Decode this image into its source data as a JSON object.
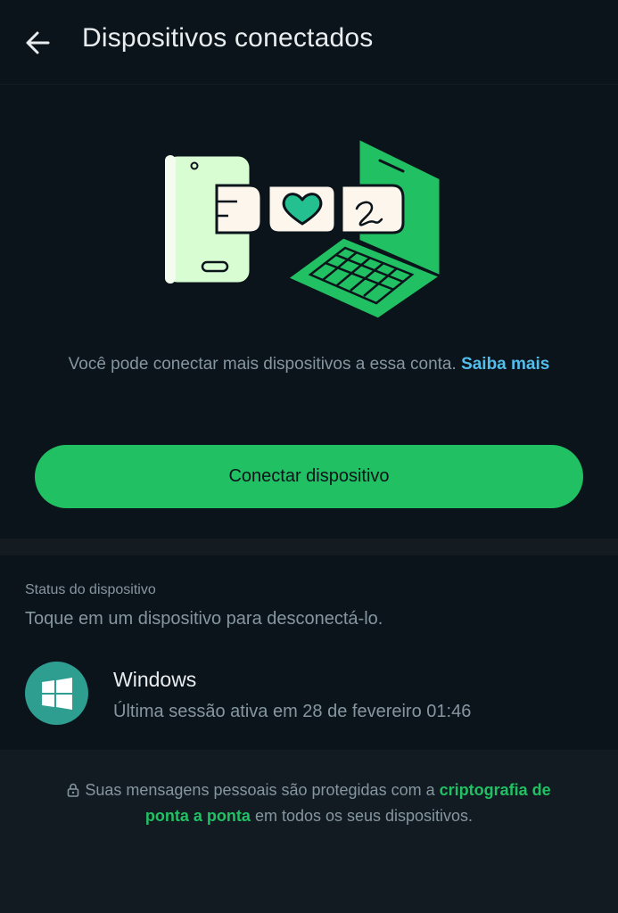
{
  "header": {
    "title": "Dispositivos conectados",
    "back_icon": "arrow-left-icon"
  },
  "illustration": {
    "icon": "phone-laptop-linked-devices-illustration",
    "colors": {
      "green": "#21c063",
      "light_green": "#d9fdd3",
      "cream": "#fdf6ec"
    }
  },
  "info": {
    "text": "Você pode conectar mais dispositivos a essa conta.",
    "link": "Saiba mais"
  },
  "connect_button": {
    "label": "Conectar dispositivo"
  },
  "device_status": {
    "label": "Status do dispositivo",
    "hint": "Toque em um dispositivo para desconectá-lo.",
    "devices": [
      {
        "name": "Windows",
        "session": "Última sessão ativa em 28 de fevereiro 01:46",
        "icon": "windows-logo-icon"
      }
    ]
  },
  "footer": {
    "icon": "lock-icon",
    "text_before": "Suas mensagens pessoais são protegidas com a",
    "link": "criptografia de ponta a ponta",
    "text_after": "em todos os seus dispositivos."
  },
  "colors": {
    "background": "#0b141a",
    "accent": "#21c063",
    "link_blue": "#53bdeb",
    "secondary_text": "#8696a0",
    "primary_text": "#e9edef",
    "avatar": "#2e9e91"
  }
}
